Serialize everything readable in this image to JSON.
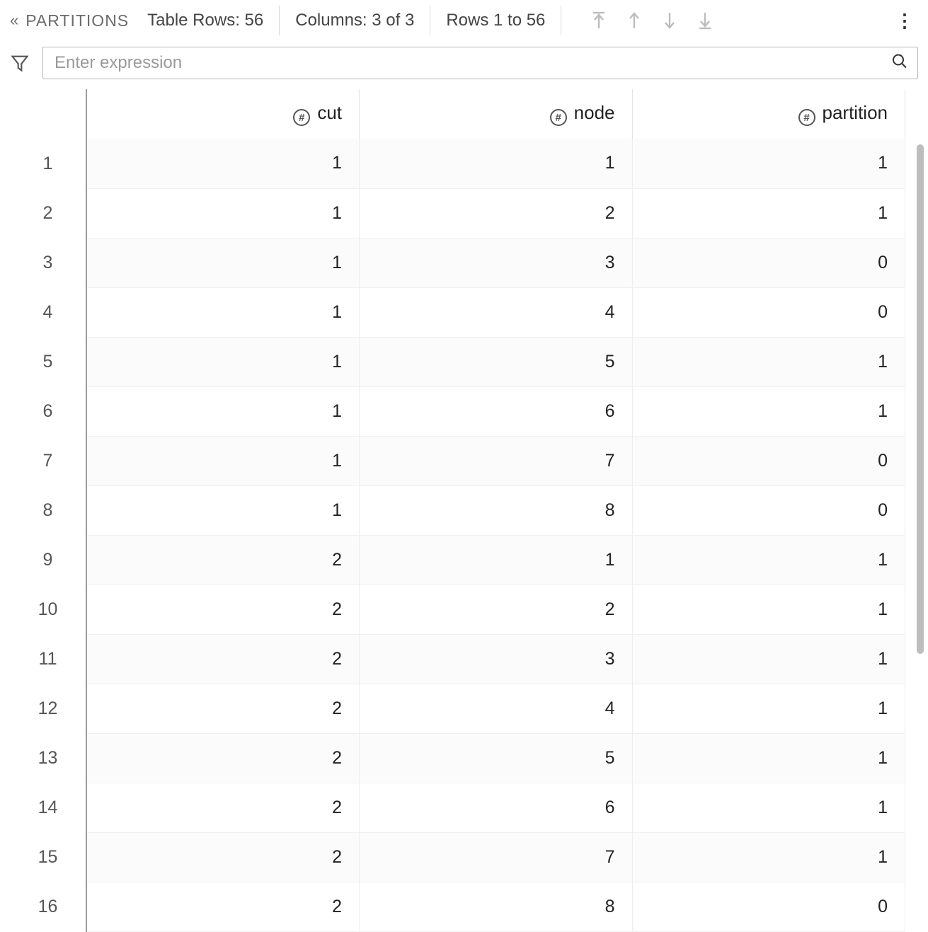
{
  "toolbar": {
    "title": "PARTITIONS",
    "table_rows_label": "Table Rows: 56",
    "columns_label": "Columns: 3 of 3",
    "rows_range_label": "Rows 1 to 56"
  },
  "filter": {
    "placeholder": "Enter expression"
  },
  "columns": [
    {
      "name": "cut",
      "type_icon": "#"
    },
    {
      "name": "node",
      "type_icon": "#"
    },
    {
      "name": "partition",
      "type_icon": "#"
    }
  ],
  "rows": [
    {
      "n": 1,
      "cut": 1,
      "node": 1,
      "partition": 1
    },
    {
      "n": 2,
      "cut": 1,
      "node": 2,
      "partition": 1
    },
    {
      "n": 3,
      "cut": 1,
      "node": 3,
      "partition": 0
    },
    {
      "n": 4,
      "cut": 1,
      "node": 4,
      "partition": 0
    },
    {
      "n": 5,
      "cut": 1,
      "node": 5,
      "partition": 1
    },
    {
      "n": 6,
      "cut": 1,
      "node": 6,
      "partition": 1
    },
    {
      "n": 7,
      "cut": 1,
      "node": 7,
      "partition": 0
    },
    {
      "n": 8,
      "cut": 1,
      "node": 8,
      "partition": 0
    },
    {
      "n": 9,
      "cut": 2,
      "node": 1,
      "partition": 1
    },
    {
      "n": 10,
      "cut": 2,
      "node": 2,
      "partition": 1
    },
    {
      "n": 11,
      "cut": 2,
      "node": 3,
      "partition": 1
    },
    {
      "n": 12,
      "cut": 2,
      "node": 4,
      "partition": 1
    },
    {
      "n": 13,
      "cut": 2,
      "node": 5,
      "partition": 1
    },
    {
      "n": 14,
      "cut": 2,
      "node": 6,
      "partition": 1
    },
    {
      "n": 15,
      "cut": 2,
      "node": 7,
      "partition": 1
    },
    {
      "n": 16,
      "cut": 2,
      "node": 8,
      "partition": 0
    }
  ]
}
